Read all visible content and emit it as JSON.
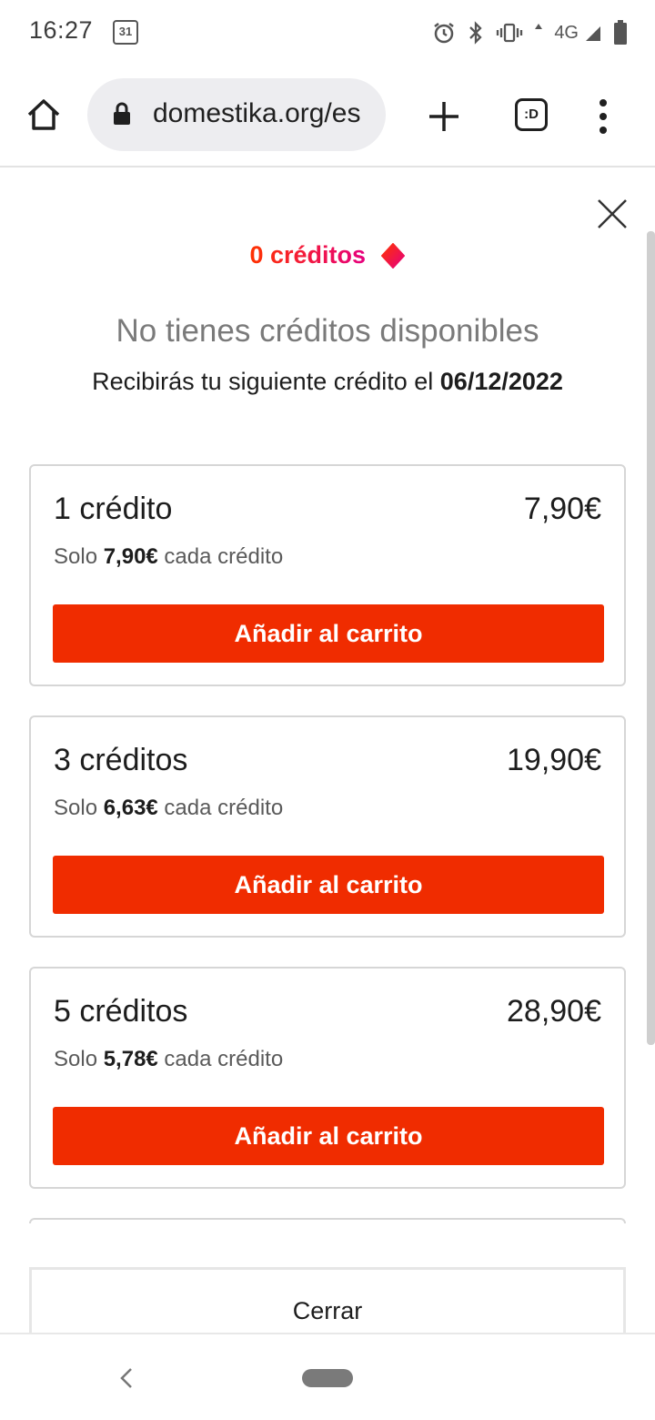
{
  "status_bar": {
    "time": "16:27",
    "calendar_day": "31",
    "network": "4G"
  },
  "browser": {
    "url": "domestika.org/es",
    "tabs_label": ":D"
  },
  "credits": {
    "balance_label": "0 créditos",
    "headline": "No tienes créditos disponibles",
    "next_prefix": "Recibirás tu siguiente crédito el ",
    "next_date": "06/12/2022",
    "brand_color": "#f02c00"
  },
  "packages": [
    {
      "title": "1 crédito",
      "price": "7,90€",
      "sub_prefix": "Solo ",
      "unit_price": "7,90€",
      "sub_suffix": " cada crédito",
      "button": "Añadir al carrito"
    },
    {
      "title": "3 créditos",
      "price": "19,90€",
      "sub_prefix": "Solo ",
      "unit_price": "6,63€",
      "sub_suffix": " cada crédito",
      "button": "Añadir al carrito"
    },
    {
      "title": "5 créditos",
      "price": "28,90€",
      "sub_prefix": "Solo ",
      "unit_price": "5,78€",
      "sub_suffix": " cada crédito",
      "button": "Añadir al carrito"
    }
  ],
  "footer": {
    "close_label": "Cerrar"
  }
}
